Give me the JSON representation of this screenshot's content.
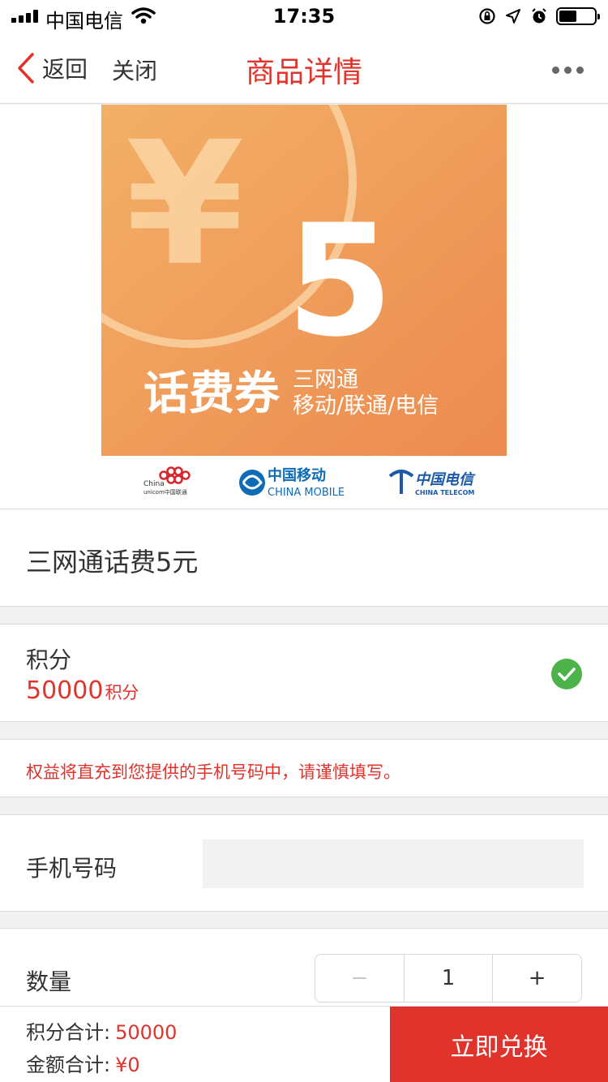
{
  "status_bar": {
    "carrier": "中国电信",
    "time": "17:35",
    "battery_level": 0.5
  },
  "nav": {
    "back_label": "返回",
    "close_label": "关闭",
    "title": "商品详情"
  },
  "hero": {
    "currency_symbol": "¥",
    "amount": "5",
    "voucher_title": "话费券",
    "networks_line1": "三网通",
    "networks_line2": "移动/联通/电信",
    "carriers": {
      "unicom_en": "China",
      "unicom_en2": "unicom中国联通",
      "mobile_cn": "中国移动",
      "mobile_en": "CHINA MOBILE",
      "telecom_cn": "中国电信",
      "telecom_en": "CHINA TELECOM"
    }
  },
  "product": {
    "name": "三网通话费5元"
  },
  "points": {
    "label": "积分",
    "value": "50000",
    "unit": "积分"
  },
  "notice": "权益将直充到您提供的手机号码中，请谨慎填写。",
  "phone": {
    "label": "手机号码",
    "value": ""
  },
  "quantity": {
    "label": "数量",
    "minus": "−",
    "value": "1",
    "plus": "+"
  },
  "footer": {
    "points_total_label": "积分合计:",
    "points_total_value": "50000",
    "amount_total_label": "金额合计:",
    "amount_total_value": "¥0",
    "redeem_label": "立即兑换"
  },
  "colors": {
    "accent": "#e0332b",
    "success": "#4db24a",
    "hero_orange_start": "#f3b067",
    "hero_orange_end": "#ec8a4f"
  }
}
